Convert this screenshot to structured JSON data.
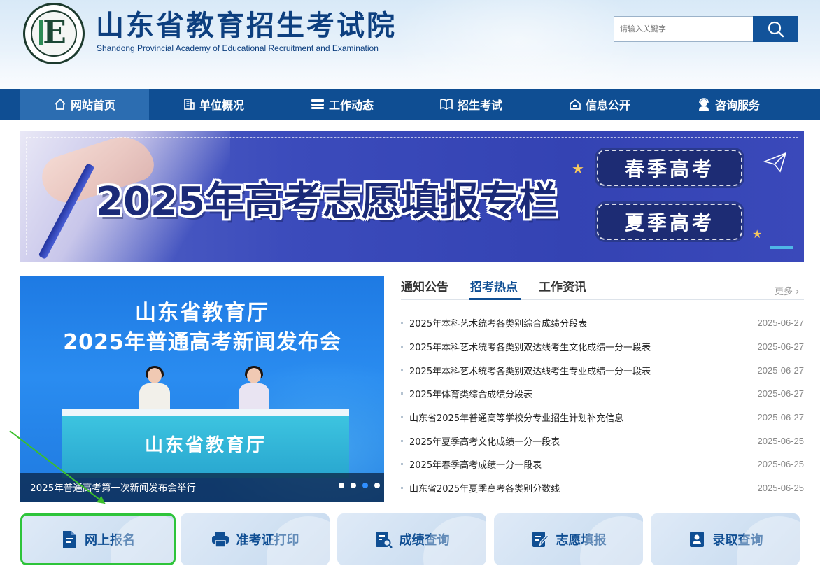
{
  "header": {
    "title_cn": "山东省教育招生考试院",
    "title_en": "Shandong Provincial Academy of Educational Recruitment and Examination",
    "logo_letter": "E",
    "search_placeholder": "请输入关键字",
    "search_icon": "search-icon"
  },
  "nav": {
    "items": [
      {
        "label": "网站首页",
        "icon": "home-icon",
        "active": true
      },
      {
        "label": "单位概况",
        "icon": "building-icon"
      },
      {
        "label": "工作动态",
        "icon": "news-icon"
      },
      {
        "label": "招生考试",
        "icon": "book-icon"
      },
      {
        "label": "信息公开",
        "icon": "info-icon"
      },
      {
        "label": "咨询服务",
        "icon": "consult-icon"
      }
    ]
  },
  "banner": {
    "headline": "2025年高考志愿填报专栏",
    "spring_label": "春季高考",
    "summer_label": "夏季高考"
  },
  "slider": {
    "line1": "山东省教育厅",
    "line2": "2025年普通高考新闻发布会",
    "desk_text": "山东省教育厅",
    "caption": "2025年普通高考第一次新闻发布会举行",
    "slide_count": 4,
    "active_slide": 3
  },
  "news": {
    "tabs": [
      {
        "label": "通知公告"
      },
      {
        "label": "招考热点",
        "active": true
      },
      {
        "label": "工作资讯"
      }
    ],
    "more_label": "更多",
    "items": [
      {
        "title": "2025年本科艺术统考各类别综合成绩分段表",
        "date": "2025-06-27"
      },
      {
        "title": "2025年本科艺术统考各类别双达线考生文化成绩一分一段表",
        "date": "2025-06-27"
      },
      {
        "title": "2025年本科艺术统考各类别双达线考生专业成绩一分一段表",
        "date": "2025-06-27"
      },
      {
        "title": "2025年体育类综合成绩分段表",
        "date": "2025-06-27"
      },
      {
        "title": "山东省2025年普通高等学校分专业招生计划补充信息",
        "date": "2025-06-27"
      },
      {
        "title": "2025年夏季高考文化成绩一分一段表",
        "date": "2025-06-25"
      },
      {
        "title": "2025年春季高考成绩一分一段表",
        "date": "2025-06-25"
      },
      {
        "title": "山东省2025年夏季高考各类别分数线",
        "date": "2025-06-25"
      }
    ]
  },
  "quick_links": [
    {
      "label": "网上报名",
      "icon": "registration-icon",
      "highlighted": true
    },
    {
      "label": "准考证打印",
      "icon": "printer-icon"
    },
    {
      "label": "成绩查询",
      "icon": "score-search-icon"
    },
    {
      "label": "志愿填报",
      "icon": "edit-form-icon"
    },
    {
      "label": "录取查询",
      "icon": "admission-icon"
    }
  ],
  "colors": {
    "brand_blue": "#0f4e93",
    "nav_active": "#2c6db1",
    "highlight_green": "#2ec43a",
    "banner_blue": "#3443b3"
  }
}
